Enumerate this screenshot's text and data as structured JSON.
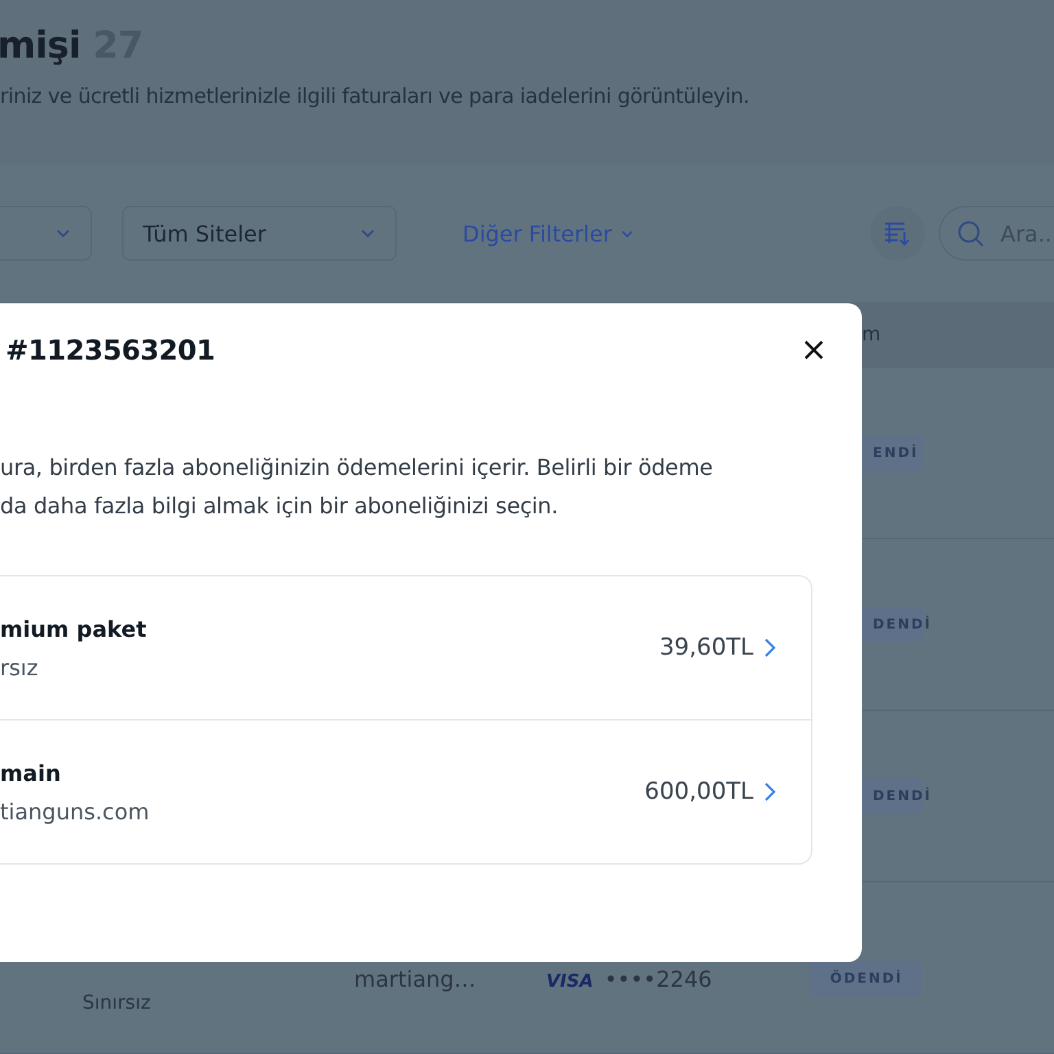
{
  "page": {
    "title": "mişi",
    "count": "27",
    "subtitle": "riniz ve ücretli hizmetlerinizle ilgili faturaları ve para iadelerini görüntüleyin."
  },
  "filters": {
    "site_filter": "Tüm Siteler",
    "more_filters": "Diğer Filterler",
    "search": {
      "placeholder": "Ara..."
    }
  },
  "table": {
    "column_header": "m",
    "rows": [
      {
        "badge": "ENDİ"
      },
      {
        "badge": "DENDİ"
      },
      {
        "badge": "DENDİ"
      },
      {
        "plan_detail": "Sınırsız",
        "site": "martiang…",
        "card_brand": "VISA",
        "card_number": "••••2246",
        "badge": "ÖDENDİ"
      }
    ]
  },
  "modal": {
    "title": "#1123563201",
    "description_lines": [
      "ura, birden fazla aboneliğinizin ödemelerini içerir. Belirli bir ödeme",
      "da daha fazla bilgi almak için bir aboneliğinizi seçin."
    ],
    "subscriptions": [
      {
        "name": "mium paket",
        "detail": "rsız",
        "price": "39,60TL"
      },
      {
        "name": "main",
        "detail": "tianguns.com",
        "price": "600,00TL"
      }
    ]
  }
}
